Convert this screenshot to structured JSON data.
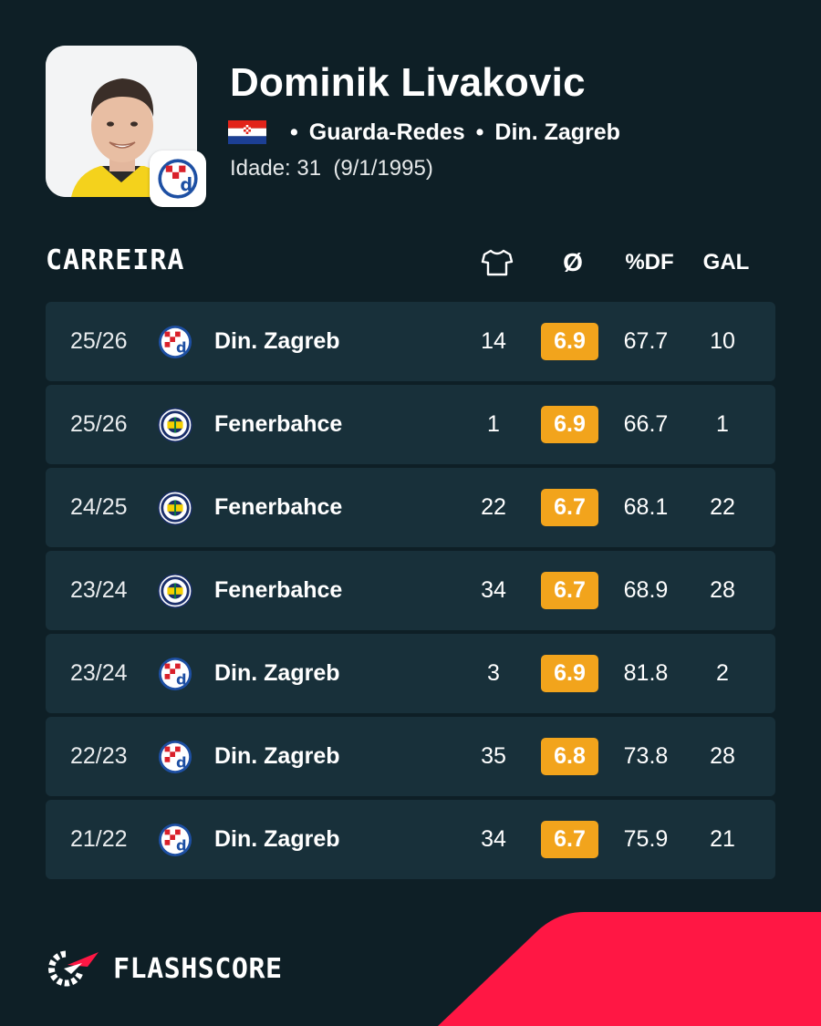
{
  "player": {
    "name": "Dominik Livakovic",
    "position": "Guarda-Redes",
    "club": "Din. Zagreb",
    "age_text": "Idade: 31  (9/1/1995)",
    "separator": "•"
  },
  "career": {
    "title": "CARREIRA",
    "columns": {
      "apps_icon": "shirt-icon",
      "avg": "Ø",
      "pct": "%DF",
      "gal": "GAL"
    },
    "rows": [
      {
        "season": "25/26",
        "club": "Din. Zagreb",
        "logo": "dinamo",
        "apps": "14",
        "rating": "6.9",
        "pct": "67.7",
        "gal": "10"
      },
      {
        "season": "25/26",
        "club": "Fenerbahce",
        "logo": "fenerbahce",
        "apps": "1",
        "rating": "6.9",
        "pct": "66.7",
        "gal": "1"
      },
      {
        "season": "24/25",
        "club": "Fenerbahce",
        "logo": "fenerbahce",
        "apps": "22",
        "rating": "6.7",
        "pct": "68.1",
        "gal": "22"
      },
      {
        "season": "23/24",
        "club": "Fenerbahce",
        "logo": "fenerbahce",
        "apps": "34",
        "rating": "6.7",
        "pct": "68.9",
        "gal": "28"
      },
      {
        "season": "23/24",
        "club": "Din. Zagreb",
        "logo": "dinamo",
        "apps": "3",
        "rating": "6.9",
        "pct": "81.8",
        "gal": "2"
      },
      {
        "season": "22/23",
        "club": "Din. Zagreb",
        "logo": "dinamo",
        "apps": "35",
        "rating": "6.8",
        "pct": "73.8",
        "gal": "28"
      },
      {
        "season": "21/22",
        "club": "Din. Zagreb",
        "logo": "dinamo",
        "apps": "34",
        "rating": "6.7",
        "pct": "75.9",
        "gal": "21"
      }
    ]
  },
  "brand": {
    "name": "FLASHSCORE"
  },
  "colors": {
    "background": "#0e1f26",
    "row": "#18303a",
    "rating": "#f2a41c",
    "accent": "#ff1744"
  }
}
